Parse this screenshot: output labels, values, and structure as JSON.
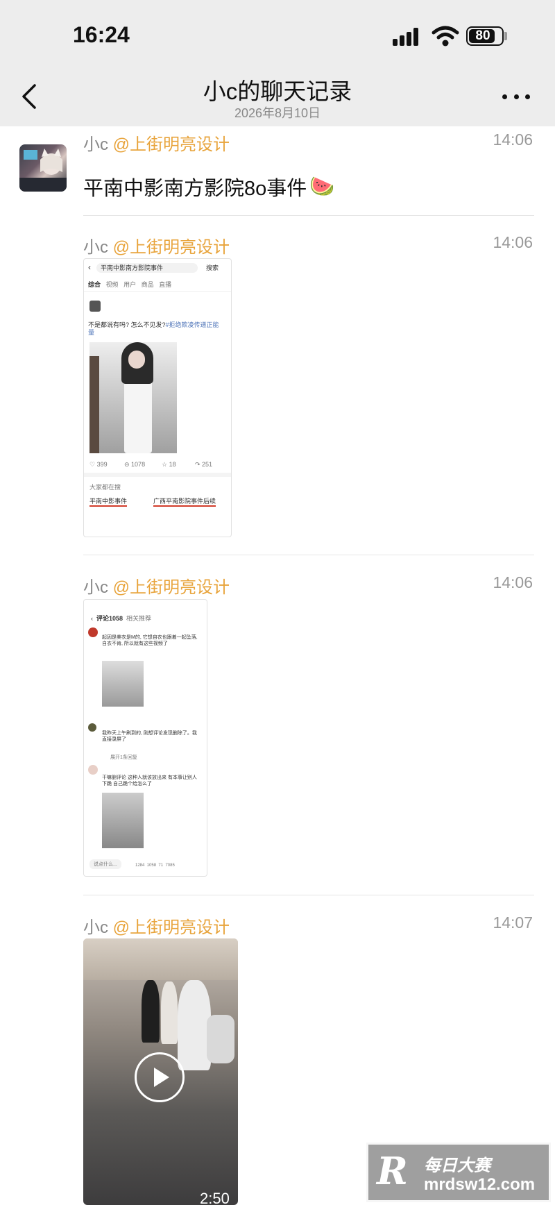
{
  "status": {
    "time": "16:24",
    "battery": "80",
    "battery_level": 0.8
  },
  "header": {
    "title": "小c的聊天记录",
    "subtitle": "2026年8月10日"
  },
  "messages": [
    {
      "sender": "小c",
      "at": "@上街明亮设计",
      "time": "14:06",
      "text": "平南中影南方影院8o事件",
      "emoji": "🍉"
    },
    {
      "sender": "小c",
      "at": "@上街明亮设计",
      "time": "14:06"
    },
    {
      "sender": "小c",
      "at": "@上街明亮设计",
      "time": "14:06"
    },
    {
      "sender": "小c",
      "at": "@上街明亮设计",
      "time": "14:07"
    }
  ],
  "shot1": {
    "search": "平南中影南方影院事件",
    "search_btn": "搜索",
    "tabs": [
      "综合",
      "视频",
      "用户",
      "商品",
      "直播"
    ],
    "post_text": "不是都说有吗? 怎么不见发?",
    "post_tag": "#拒绝欺凌传递正能量",
    "stats": [
      "399",
      "1078",
      "18",
      "251"
    ],
    "section": "大家都在搜",
    "chips": [
      "平南中影事件",
      "广西平南影院事件后续"
    ]
  },
  "shot2": {
    "header": "评论1058",
    "header2": "相关推荐",
    "c1": "起因是美衣是M的, 它想自衣也跟着一起坠落, 自衣不肯, 所以就有这些视频了",
    "c2": "我昨天上午刷到的, 刚想评论发现删除了。我直接录屏了",
    "c3": "干嘛删评论 这种人就该放出来 有本事让别人下跪 自己跪个给怎么了",
    "reply": "展开1条回复",
    "input": "说点什么...",
    "stats": [
      "1284",
      "1058",
      "71",
      "7085"
    ]
  },
  "video": {
    "duration": "2:50"
  },
  "watermark": {
    "logo": "R",
    "name": "每日大赛",
    "url": "mrdsw12.com"
  }
}
